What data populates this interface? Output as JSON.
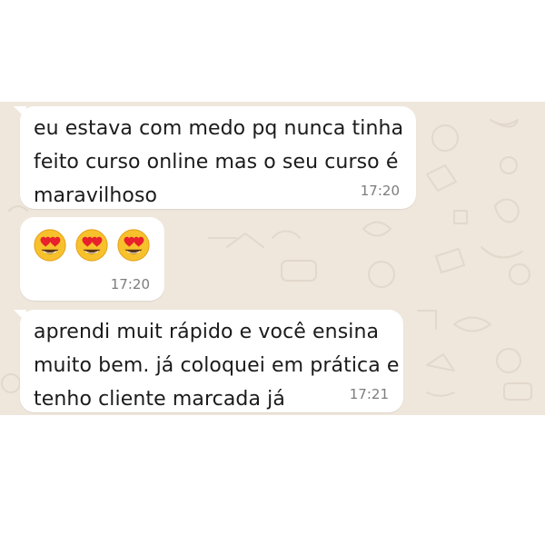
{
  "colors": {
    "chat_background": "#efe7dc",
    "bubble": "#ffffff",
    "time": "#7d7d7d"
  },
  "messages": [
    {
      "text": "eu estava com medo pq nunca tinha\nfeito curso online mas o seu curso é\nmaravilhoso",
      "time": "17:20"
    },
    {
      "emojis": [
        "heart-eyes-emoji",
        "heart-eyes-emoji",
        "heart-eyes-emoji"
      ],
      "time": "17:20"
    },
    {
      "text": "aprendi muit rápido e você ensina\nmuito bem. já coloquei em prática e\ntenho cliente marcada já",
      "time": "17:21"
    }
  ]
}
